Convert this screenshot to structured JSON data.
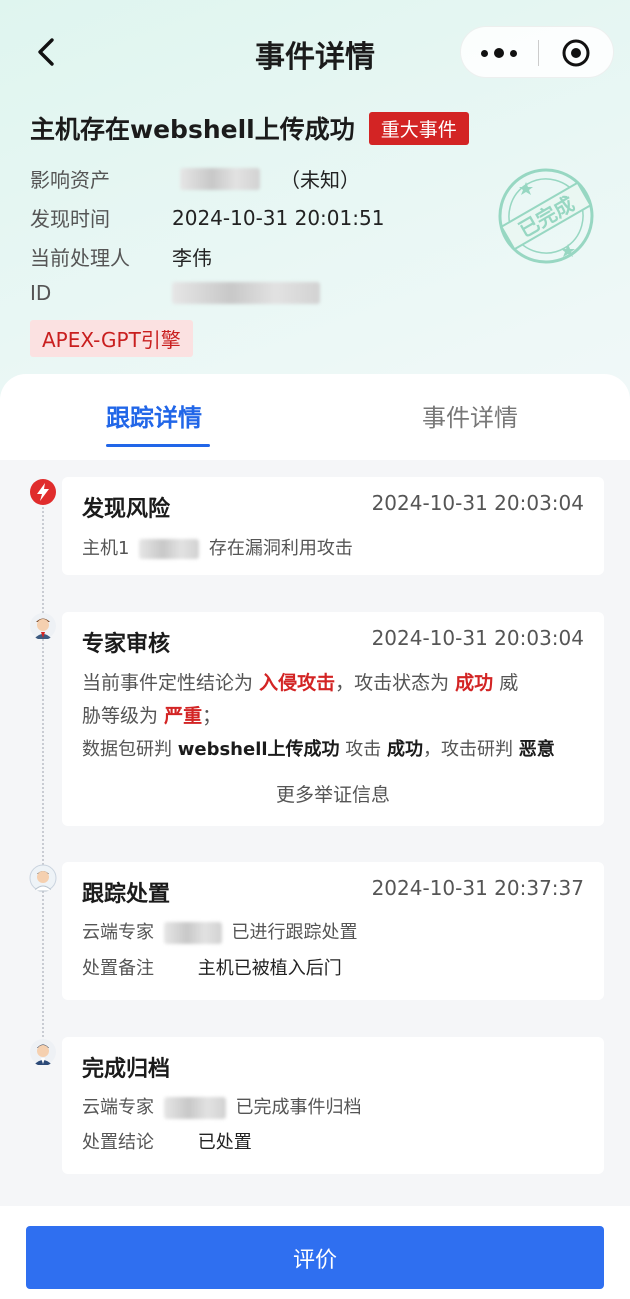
{
  "nav": {
    "title": "事件详情"
  },
  "event": {
    "title": "主机存在webshell上传成功",
    "severity": "重大事件",
    "asset_label": "影响资产",
    "asset_value": "（未知）",
    "time_label": "发现时间",
    "time_value": "2024-10-31 20:01:51",
    "handler_label": "当前处理人",
    "handler_value": "李伟",
    "id_label": "ID",
    "engine": "APEX-GPT引擎",
    "stamp_text": "已完成"
  },
  "tabs": [
    {
      "label": "跟踪详情",
      "active": true
    },
    {
      "label": "事件详情",
      "active": false
    }
  ],
  "timeline": {
    "risk": {
      "title": "发现风险",
      "time": "2024-10-31 20:03:04",
      "prefix": "主机1",
      "suffix": "存在漏洞利用攻击"
    },
    "review": {
      "title": "专家审核",
      "time": "2024-10-31 20:03:04",
      "l1a": "当前事件定性结论为",
      "l1b": "入侵攻击",
      "l1c": "，攻击状态为",
      "l1d": "成功",
      "l1e": "威",
      "l2a": "胁等级为",
      "l2b": "严重",
      "l2c": "；",
      "l3a": "数据包研判",
      "l3b": "webshell上传成功",
      "l3c": "攻击",
      "l3d": "成功",
      "l3e": "，攻击研判",
      "l3f": "恶意",
      "more": "更多举证信息"
    },
    "track": {
      "title": "跟踪处置",
      "time": "2024-10-31 20:37:37",
      "l1a": "云端专家",
      "l1b": "已进行跟踪处置",
      "note_label": "处置备注",
      "note_value": "主机已被植入后门"
    },
    "archive": {
      "title": "完成归档",
      "l1a": "云端专家",
      "l1b": "已完成事件归档",
      "conclusion_label": "处置结论",
      "conclusion_value": "已处置"
    }
  },
  "footer": {
    "rate_label": "评价"
  },
  "colors": {
    "accent": "#2166e8",
    "danger": "#d32424",
    "button": "#2f6ff0"
  }
}
